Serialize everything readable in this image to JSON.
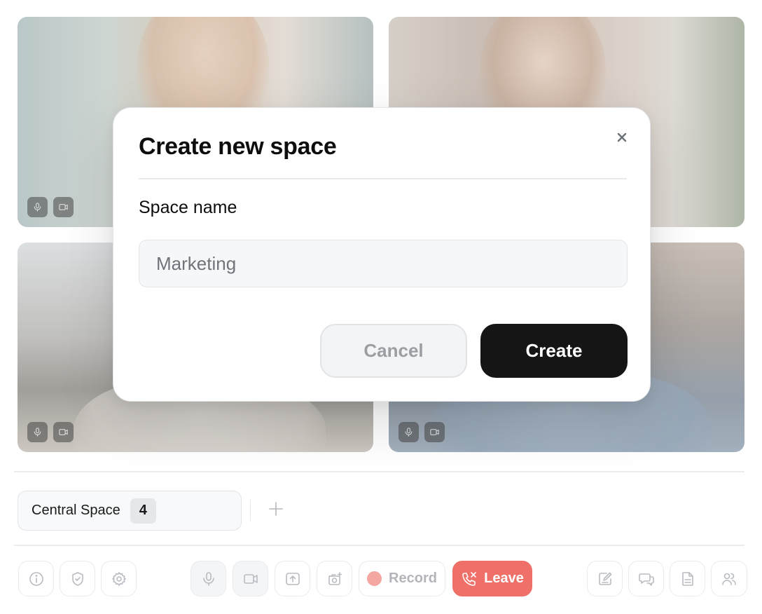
{
  "modal": {
    "title": "Create new space",
    "field_label": "Space name",
    "input_value": "Marketing",
    "cancel_label": "Cancel",
    "create_label": "Create"
  },
  "participants": [
    {
      "mic": "microphone-icon",
      "camera": "video-camera-icon"
    },
    {
      "mic": "microphone-icon",
      "camera": "video-camera-icon"
    },
    {
      "mic": "microphone-icon",
      "camera": "video-camera-icon"
    },
    {
      "mic": "microphone-icon",
      "camera": "video-camera-icon"
    }
  ],
  "spaces": [
    {
      "label": "Central Space",
      "count": "4"
    }
  ],
  "toolbar": {
    "left": [
      "info-icon",
      "shield-check-icon",
      "settings-gear-icon"
    ],
    "center": [
      "microphone-icon",
      "video-camera-icon",
      "share-screen-icon",
      "camera-snapshot-icon"
    ],
    "record_label": "Record",
    "leave_label": "Leave",
    "right": [
      "notes-icon",
      "chat-icon",
      "document-icon",
      "participants-icon"
    ]
  },
  "colors": {
    "leave_button": "#ef6f69",
    "record_dot": "#f4a6a1",
    "create_button": "#151515"
  }
}
